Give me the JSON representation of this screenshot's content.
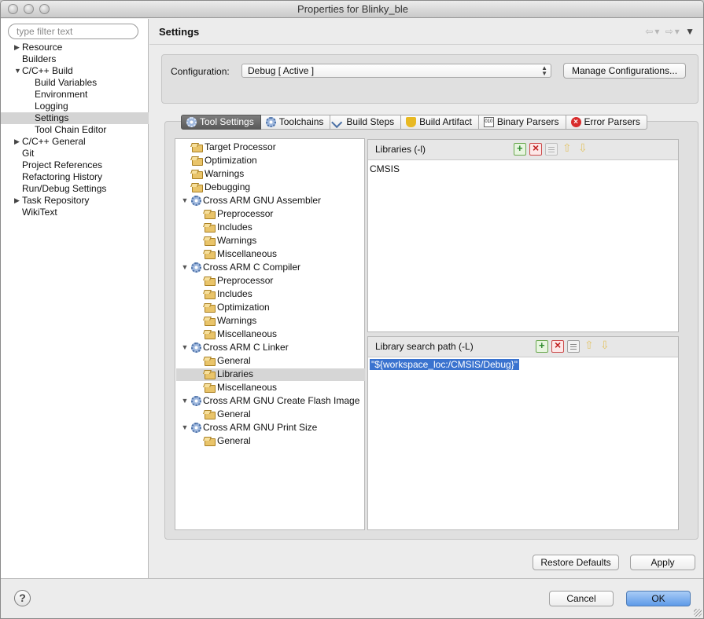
{
  "window": {
    "title": "Properties for Blinky_ble"
  },
  "filter": {
    "placeholder": "type filter text"
  },
  "sidebar": {
    "items": [
      {
        "label": "Resource",
        "level": 0,
        "expander": "collapsed"
      },
      {
        "label": "Builders",
        "level": 0,
        "expander": "none"
      },
      {
        "label": "C/C++ Build",
        "level": 0,
        "expander": "expanded"
      },
      {
        "label": "Build Variables",
        "level": 1,
        "expander": "none"
      },
      {
        "label": "Environment",
        "level": 1,
        "expander": "none"
      },
      {
        "label": "Logging",
        "level": 1,
        "expander": "none"
      },
      {
        "label": "Settings",
        "level": 1,
        "expander": "none",
        "selected": true
      },
      {
        "label": "Tool Chain Editor",
        "level": 1,
        "expander": "none"
      },
      {
        "label": "C/C++ General",
        "level": 0,
        "expander": "collapsed"
      },
      {
        "label": "Git",
        "level": 0,
        "expander": "none"
      },
      {
        "label": "Project References",
        "level": 0,
        "expander": "none"
      },
      {
        "label": "Refactoring History",
        "level": 0,
        "expander": "none"
      },
      {
        "label": "Run/Debug Settings",
        "level": 0,
        "expander": "none"
      },
      {
        "label": "Task Repository",
        "level": 0,
        "expander": "collapsed"
      },
      {
        "label": "WikiText",
        "level": 0,
        "expander": "none"
      }
    ]
  },
  "header": {
    "title": "Settings"
  },
  "configuration": {
    "label": "Configuration:",
    "value": "Debug  [ Active ]",
    "manage_button": "Manage Configurations..."
  },
  "tabs": [
    {
      "label": "Tool Settings",
      "icon": "tool-settings-icon",
      "active": true
    },
    {
      "label": "Toolchains",
      "icon": "toolchains-icon",
      "active": false
    },
    {
      "label": "Build Steps",
      "icon": "build-steps-icon",
      "active": false
    },
    {
      "label": "Build Artifact",
      "icon": "trophy-icon",
      "active": false
    },
    {
      "label": "Binary Parsers",
      "icon": "binary-icon",
      "active": false
    },
    {
      "label": "Error Parsers",
      "icon": "error-icon",
      "active": false
    }
  ],
  "tool_tree": [
    {
      "label": "Target Processor",
      "level": 0,
      "type": "folder"
    },
    {
      "label": "Optimization",
      "level": 0,
      "type": "folder"
    },
    {
      "label": "Warnings",
      "level": 0,
      "type": "folder"
    },
    {
      "label": "Debugging",
      "level": 0,
      "type": "folder"
    },
    {
      "label": "Cross ARM GNU Assembler",
      "level": 0,
      "type": "tool"
    },
    {
      "label": "Preprocessor",
      "level": 1,
      "type": "folder"
    },
    {
      "label": "Includes",
      "level": 1,
      "type": "folder"
    },
    {
      "label": "Warnings",
      "level": 1,
      "type": "folder"
    },
    {
      "label": "Miscellaneous",
      "level": 1,
      "type": "folder"
    },
    {
      "label": "Cross ARM C Compiler",
      "level": 0,
      "type": "tool"
    },
    {
      "label": "Preprocessor",
      "level": 1,
      "type": "folder"
    },
    {
      "label": "Includes",
      "level": 1,
      "type": "folder"
    },
    {
      "label": "Optimization",
      "level": 1,
      "type": "folder"
    },
    {
      "label": "Warnings",
      "level": 1,
      "type": "folder"
    },
    {
      "label": "Miscellaneous",
      "level": 1,
      "type": "folder"
    },
    {
      "label": "Cross ARM C Linker",
      "level": 0,
      "type": "tool"
    },
    {
      "label": "General",
      "level": 1,
      "type": "folder"
    },
    {
      "label": "Libraries",
      "level": 1,
      "type": "folder",
      "selected": true
    },
    {
      "label": "Miscellaneous",
      "level": 1,
      "type": "folder"
    },
    {
      "label": "Cross ARM GNU Create Flash Image",
      "level": 0,
      "type": "tool"
    },
    {
      "label": "General",
      "level": 1,
      "type": "folder"
    },
    {
      "label": "Cross ARM GNU Print Size",
      "level": 0,
      "type": "tool"
    },
    {
      "label": "General",
      "level": 1,
      "type": "folder"
    }
  ],
  "libraries_panel": {
    "title": "Libraries (-l)",
    "items": [
      "CMSIS"
    ]
  },
  "search_path_panel": {
    "title": "Library search path (-L)",
    "items": [
      "\"${workspace_loc:/CMSIS/Debug}\""
    ]
  },
  "buttons": {
    "restore_defaults": "Restore Defaults",
    "apply": "Apply",
    "cancel": "Cancel",
    "ok": "OK",
    "help": "?"
  },
  "colors": {
    "selection": "#3a73cf",
    "default_button": "#5e9ae8"
  }
}
